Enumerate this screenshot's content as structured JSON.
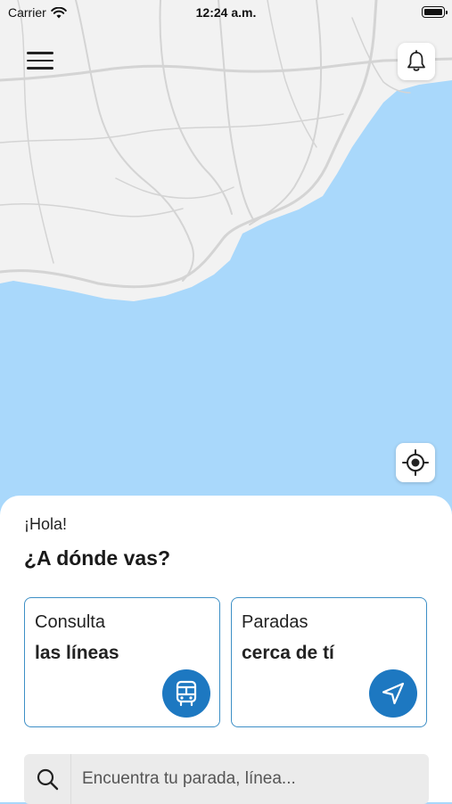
{
  "status_bar": {
    "carrier": "Carrier",
    "time": "12:24 a.m."
  },
  "map": {
    "land_color": "#f2f2f2",
    "sea_color": "#a9d8fb",
    "road_color": "#d4d4d4"
  },
  "header": {
    "menu_icon": "hamburger-menu-icon",
    "notifications_icon": "bell-icon"
  },
  "locate_button": {
    "icon": "crosshair-icon"
  },
  "sheet": {
    "greeting": "¡Hola!",
    "question": "¿A dónde vas?",
    "cards": [
      {
        "line1": "Consulta",
        "line2": "las líneas",
        "icon": "bus-icon"
      },
      {
        "line1": "Paradas",
        "line2": "cerca de tí",
        "icon": "navigation-arrow-icon"
      }
    ],
    "search": {
      "placeholder": "Encuentra tu parada, línea...",
      "icon": "search-icon"
    }
  },
  "colors": {
    "accent": "#1d78c1",
    "card_border": "#3d8fc6",
    "search_bg": "#ebebeb"
  }
}
